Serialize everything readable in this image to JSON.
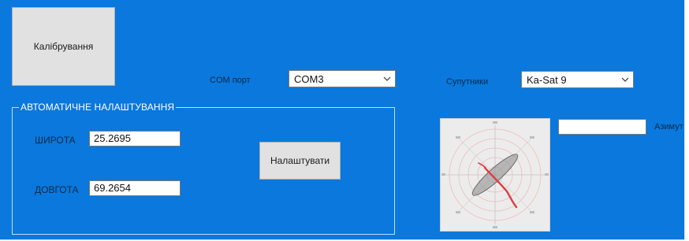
{
  "calibration": {
    "label": "Калібрування"
  },
  "com": {
    "label": "COM порт",
    "selected": "COM3"
  },
  "satellites": {
    "label": "Супутники",
    "selected": "Ka-Sat 9"
  },
  "auto_setup": {
    "title": "АВТОМАТИЧНЕ НАЛАШТУВАННЯ",
    "latitude_label": "ШИРОТА",
    "latitude_value": "25.2695",
    "longitude_label": "ДОВГОТА",
    "longitude_value": "69.2654",
    "apply_button": "Налаштувати"
  },
  "azimuth": {
    "label": "Азимут",
    "value": ""
  },
  "colors": {
    "form_background": "#0a78dc",
    "button_face": "#e1e1e1",
    "plot_background": "#ececec",
    "plot_main_lobe": "#e03c3c",
    "plot_side_lobe": "#707070"
  },
  "icons": {
    "combo_arrow": "chevron-down-icon",
    "plot": "polar-plot-icon"
  }
}
